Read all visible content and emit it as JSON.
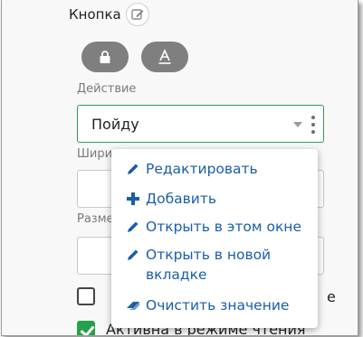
{
  "section": {
    "title": "Кнопка"
  },
  "icons": {
    "edit_title": "pencil-icon",
    "button_lock": "lock-icon",
    "button_text": "text-style-icon"
  },
  "fields": {
    "action_label": "Действие",
    "action_value": "Пойду",
    "width_label": "Шири",
    "size_label": "Разме"
  },
  "checkboxes": [
    {
      "label": "е",
      "checked": false
    },
    {
      "label": "Активна в режиме чтения",
      "checked": true
    }
  ],
  "menu": {
    "items": [
      {
        "label": "Редактировать",
        "icon": "pencil-icon"
      },
      {
        "label": "Добавить",
        "icon": "plus-icon"
      },
      {
        "label": "Открыть в этом окне",
        "icon": "pencil-icon"
      },
      {
        "label": "Открыть в новой вкладке",
        "icon": "pencil-icon"
      },
      {
        "label": "Очистить значение",
        "icon": "eraser-icon"
      }
    ]
  },
  "colors": {
    "accent_green": "#2e9a5a",
    "menu_text": "#1a5ea8",
    "checkbox_checked": "#24a24a"
  }
}
